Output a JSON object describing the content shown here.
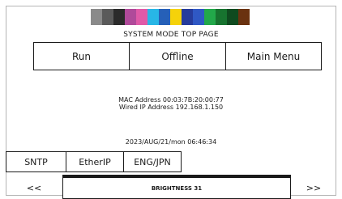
{
  "palette": [
    "#8a8a8a",
    "#5a5a5a",
    "#2b2b2b",
    "#b04a9a",
    "#e05aa8",
    "#28b6e6",
    "#2660b8",
    "#f5d20a",
    "#263c9c",
    "#2f58c4",
    "#22a84a",
    "#17732f",
    "#0f4a1f",
    "#6a3210"
  ],
  "header": {
    "title": "SYSTEM MODE TOP PAGE"
  },
  "menu": {
    "run": "Run",
    "offline": "Offline",
    "main_menu": "Main Menu"
  },
  "network": {
    "mac_line": "MAC Address  00:03:7B:20:00:77",
    "ip_line": "Wired IP Address  192.168.1.150"
  },
  "datetime": "2023/AUG/21/mon 06:46:34",
  "tabs": {
    "sntp": "SNTP",
    "etherip": "EtherIP",
    "eng_jpn": "ENG/JPN"
  },
  "footer": {
    "prev": "<<",
    "brightness": "BRIGHTNESS 31",
    "next": ">>"
  }
}
